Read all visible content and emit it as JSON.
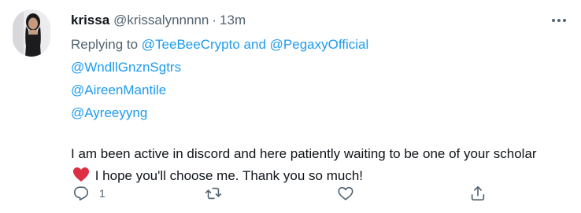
{
  "tweet": {
    "author_name": "krissa",
    "author_handle": "@krissalynnnnn",
    "separator": "·",
    "time": "13m",
    "replying_prefix": "Replying to",
    "replying_to_1": "@TeeBeeCrypto",
    "replying_and": "and",
    "replying_to_2": "@PegaxyOfficial",
    "mentions": [
      "@WndllGnznSgtrs",
      "@AireenMantile",
      "@Ayreeyyng"
    ],
    "text_part1": "I am been active in discord and here patiently waiting to be one of your scholar",
    "text_part2": " I hope you'll choose me. Thank you so much!",
    "emoji": "red-heart"
  },
  "actions": {
    "reply_count": "1",
    "retweet_count": "",
    "like_count": ""
  },
  "icons": {
    "more": "more-horizontal-icon",
    "reply": "reply-icon",
    "retweet": "retweet-icon",
    "like": "like-icon",
    "share": "share-icon"
  },
  "colors": {
    "link": "#1d9bf0",
    "secondary": "#536471",
    "text": "#0f1419",
    "heart": "#e0245e"
  }
}
